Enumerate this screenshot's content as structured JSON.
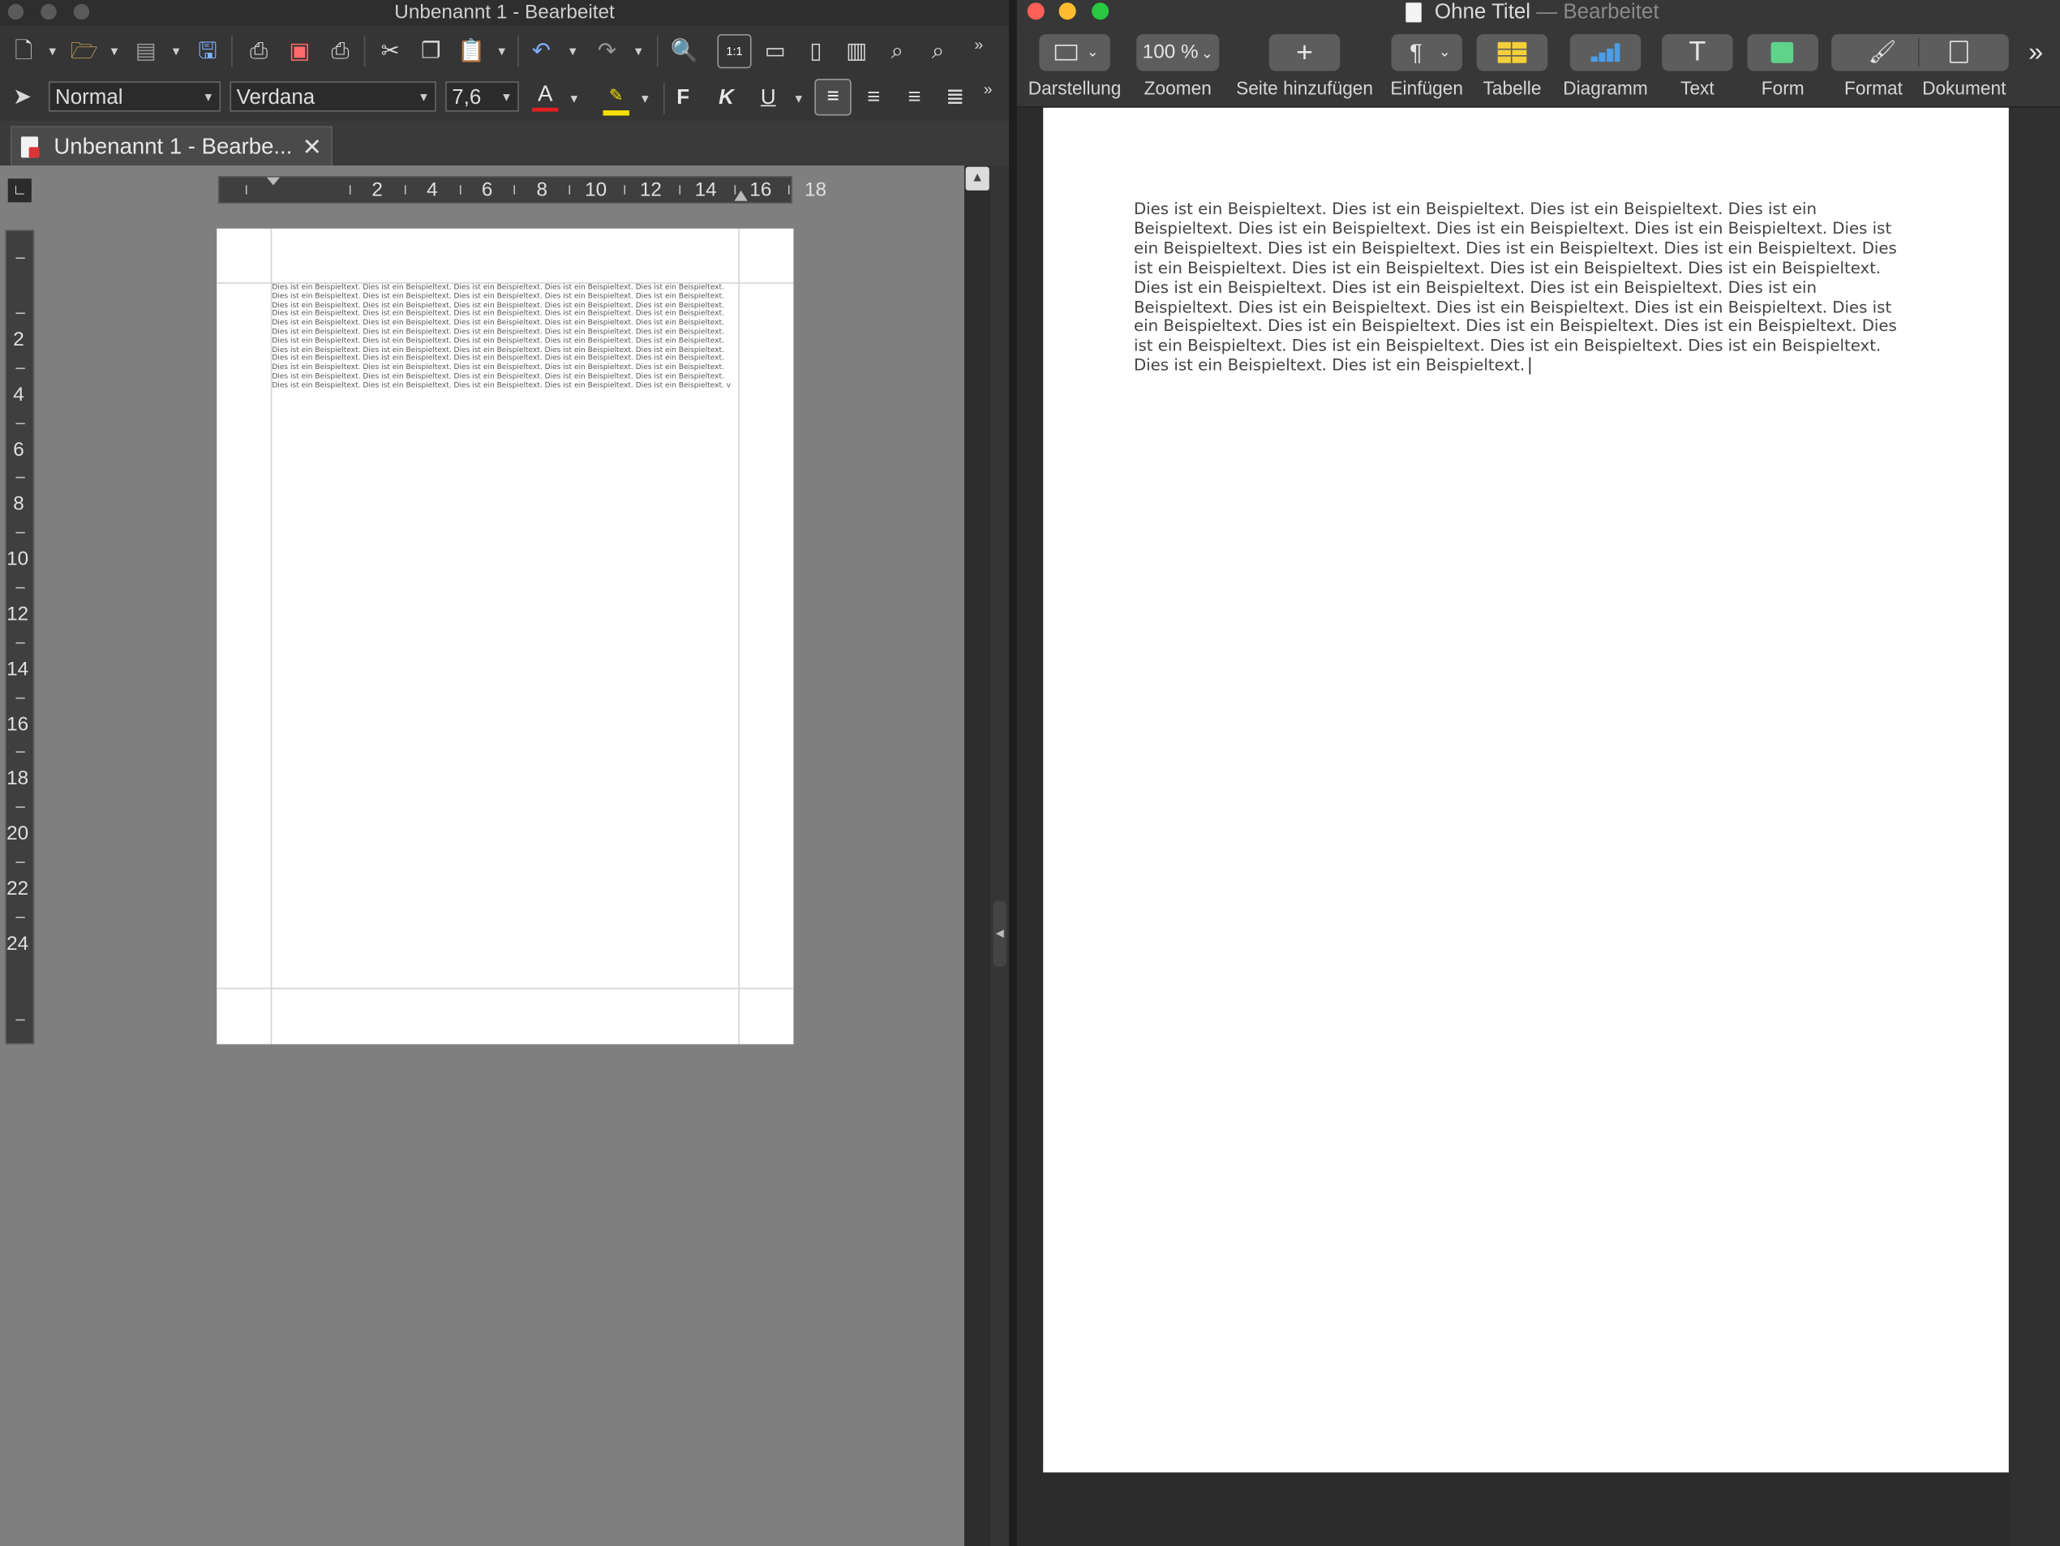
{
  "lo": {
    "title": "Unbenannt 1 - Bearbeitet",
    "tab_label": "Unbenannt 1 - Bearbe...",
    "paragraph_style": "Normal",
    "font_name": "Verdana",
    "font_size": "7,6",
    "bold_label": "F",
    "italic_label": "K",
    "underline_label": "U",
    "font_color_label": "A",
    "zoom_label": "1:1",
    "hruler": [
      "2",
      "4",
      "6",
      "8",
      "10",
      "12",
      "14",
      "16",
      "18"
    ],
    "vruler": [
      "2",
      "4",
      "6",
      "8",
      "10",
      "12",
      "14",
      "16",
      "18",
      "20",
      "22",
      "24"
    ],
    "doc_text": "Dies ist ein Beispieltext. Dies ist ein Beispieltext. Dies ist ein Beispieltext. Dies ist ein Beispieltext. Dies ist ein Beispieltext. Dies ist ein Beispieltext. Dies ist ein Beispieltext. Dies ist ein Beispieltext. Dies ist ein Beispieltext. Dies ist ein Beispieltext. Dies ist ein Beispieltext. Dies ist ein Beispieltext. Dies ist ein Beispieltext. Dies ist ein Beispieltext. Dies ist ein Beispieltext. Dies ist ein Beispieltext. Dies ist ein Beispieltext. Dies ist ein Beispieltext. Dies ist ein Beispieltext. Dies ist ein Beispieltext. Dies ist ein Beispieltext. Dies ist ein Beispieltext. Dies ist ein Beispieltext. Dies ist ein Beispieltext. Dies ist ein Beispieltext. Dies ist ein Beispieltext. Dies ist ein Beispieltext. Dies ist ein Beispieltext. Dies ist ein Beispieltext. Dies ist ein Beispieltext. Dies ist ein Beispieltext. Dies ist ein Beispieltext. Dies ist ein Beispieltext. Dies ist ein Beispieltext. Dies ist ein Beispieltext. Dies ist ein Beispieltext. Dies ist ein Beispieltext. Dies ist ein Beispieltext. Dies ist ein Beispieltext. Dies ist ein Beispieltext. Dies ist ein Beispieltext. Dies ist ein Beispieltext. Dies ist ein Beispieltext. Dies ist ein Beispieltext. Dies ist ein Beispieltext. Dies ist ein Beispieltext. Dies ist ein Beispieltext. Dies ist ein Beispieltext. Dies ist ein Beispieltext. Dies ist ein Beispieltext. Dies ist ein Beispieltext. Dies ist ein Beispieltext. Dies ist ein Beispieltext. Dies ist ein Beispieltext. Dies ist ein Beispieltext. Dies ist ein Beispieltext. Dies ist ein Beispieltext. Dies ist ein Beispieltext. Dies ist ein Beispieltext. Dies ist ein Beispieltext. v"
  },
  "pages": {
    "title_main": "Ohne Titel",
    "title_sep": " — ",
    "title_status": "Bearbeitet",
    "zoom_value": "100 %",
    "labels": {
      "view": "Darstellung",
      "zoom": "Zoomen",
      "add_page": "Seite hinzufügen",
      "insert": "Einfügen",
      "table": "Tabelle",
      "chart": "Diagramm",
      "text": "Text",
      "shape": "Form",
      "format": "Format",
      "document": "Dokument"
    },
    "doc_text": "Dies ist ein Beispieltext. Dies ist ein Beispieltext. Dies ist ein Beispieltext. Dies ist ein Beispieltext. Dies ist ein Beispieltext. Dies ist ein Beispieltext. Dies ist ein Beispieltext. Dies ist ein Beispieltext. Dies ist ein Beispieltext. Dies ist ein Beispieltext. Dies ist ein Beispieltext. Dies ist ein Beispieltext. Dies ist ein Beispieltext. Dies ist ein Beispieltext. Dies ist ein Beispieltext. Dies ist ein Beispieltext. Dies ist ein Beispieltext. Dies ist ein Beispieltext. Dies ist ein Beispieltext. Dies ist ein Beispieltext. Dies ist ein Beispieltext. Dies ist ein Beispieltext. Dies ist ein Beispieltext. Dies ist ein Beispieltext. Dies ist ein Beispieltext. Dies ist ein Beispieltext. Dies ist ein Beispieltext. Dies ist ein Beispieltext. Dies ist ein Beispieltext. Dies ist ein Beispieltext. Dies ist ein Beispieltext. Dies ist ein Beispieltext."
  },
  "colors": {
    "font_color_underline": "#e02020",
    "highlight": "#f5e000",
    "traffic_close": "#ff5f57",
    "traffic_min": "#febc2e",
    "traffic_max": "#28c840",
    "shape_green": "#5fd38a",
    "table_yellow": "#f3cf3a",
    "chart_blue": "#4a9de8"
  }
}
